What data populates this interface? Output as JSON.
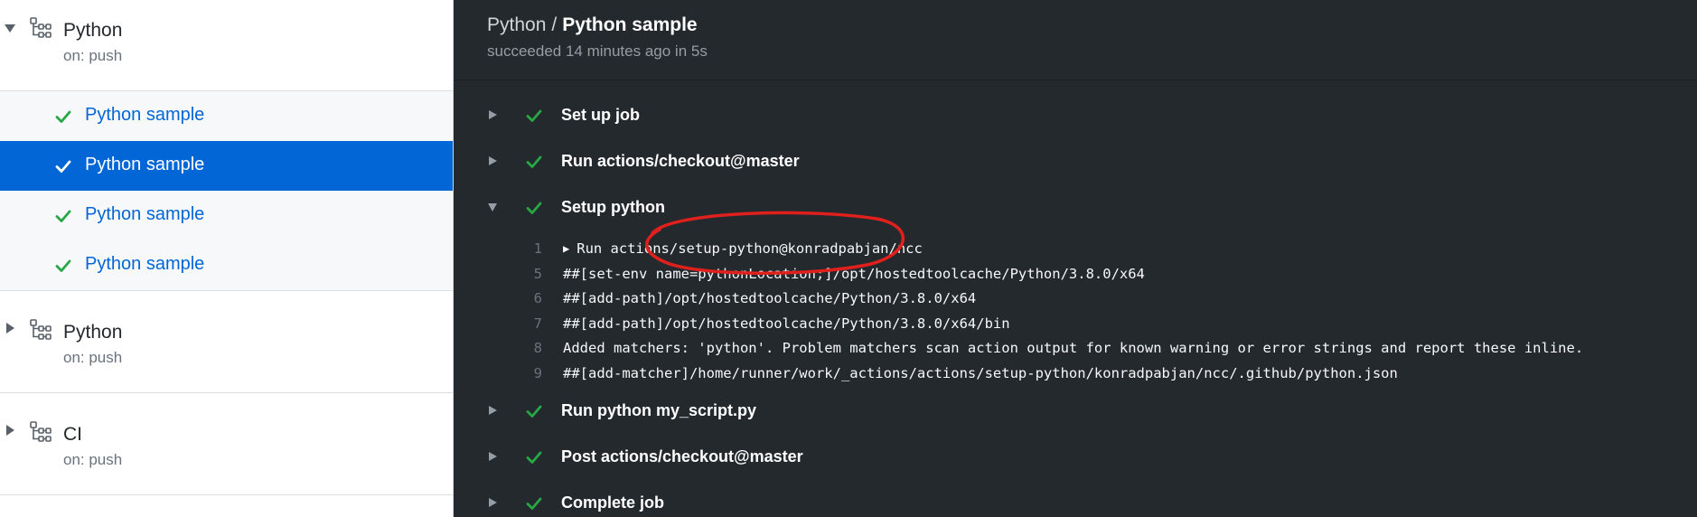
{
  "sidebar": {
    "workflows": [
      {
        "title": "Python",
        "trigger": "on: push",
        "expanded": true,
        "jobs": [
          {
            "label": "Python sample",
            "status": "success",
            "active": false
          },
          {
            "label": "Python sample",
            "status": "success",
            "active": true
          },
          {
            "label": "Python sample",
            "status": "success",
            "active": false
          },
          {
            "label": "Python sample",
            "status": "success",
            "active": false
          }
        ]
      },
      {
        "title": "Python",
        "trigger": "on: push",
        "expanded": false
      },
      {
        "title": "CI",
        "trigger": "on: push",
        "expanded": false
      }
    ]
  },
  "main": {
    "breadcrumb": {
      "workflow": "Python",
      "separator": "/",
      "job": "Python sample"
    },
    "status_line": "succeeded 14 minutes ago in 5s",
    "steps": [
      {
        "label": "Set up job",
        "expanded": false
      },
      {
        "label": "Run actions/checkout@master",
        "expanded": false
      },
      {
        "label": "Setup python",
        "expanded": true
      },
      {
        "label": "Run python my_script.py",
        "expanded": false
      },
      {
        "label": "Post actions/checkout@master",
        "expanded": false
      },
      {
        "label": "Complete job",
        "expanded": false
      }
    ],
    "log": [
      {
        "num": "1",
        "text": "Run actions/setup-python@konradpabjan/ncc"
      },
      {
        "num": "5",
        "text": "##[set-env name=pythonLocation;]/opt/hostedtoolcache/Python/3.8.0/x64"
      },
      {
        "num": "6",
        "text": "##[add-path]/opt/hostedtoolcache/Python/3.8.0/x64"
      },
      {
        "num": "7",
        "text": "##[add-path]/opt/hostedtoolcache/Python/3.8.0/x64/bin"
      },
      {
        "num": "8",
        "text": "Added matchers: 'python'. Problem matchers scan action output for known warning or error strings and report these inline."
      },
      {
        "num": "9",
        "text": "##[add-matcher]/home/runner/work/_actions/actions/setup-python/konradpabjan/ncc/.github/python.json"
      }
    ]
  },
  "colors": {
    "success_green": "#28a745",
    "link_blue": "#0366d6",
    "dark_bg": "#24292e",
    "annotation_red": "#e0201c"
  }
}
